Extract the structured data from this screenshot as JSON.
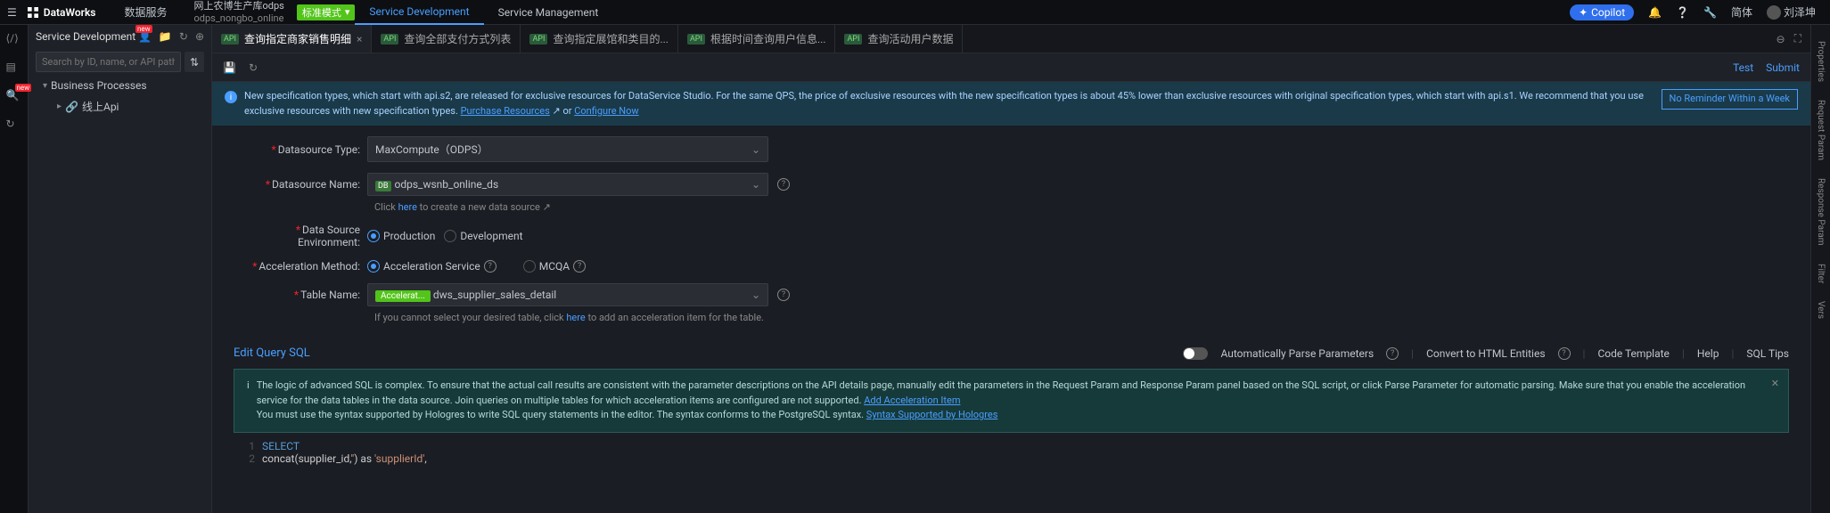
{
  "top": {
    "brand": "DataWorks",
    "nav1": "数据服务",
    "proj1": "网上农博生产库odps",
    "proj2": "odps_nongbo_online",
    "env": "标准模式",
    "nav_active": "Service Development",
    "nav2": "Service Management",
    "copilot": "Copilot",
    "lang": "简体",
    "user": "刘泽坤"
  },
  "side": {
    "title": "Service Development",
    "search_ph": "Search by ID, name, or API path",
    "root": "Business Processes",
    "child": "线上Api"
  },
  "tabs": [
    {
      "label": "查询指定商家销售明细",
      "active": true
    },
    {
      "label": "查询全部支付方式列表"
    },
    {
      "label": "查询指定展馆和类目的..."
    },
    {
      "label": "根据时间查询用户信息..."
    },
    {
      "label": "查询活动用户数据"
    }
  ],
  "toolbar": {
    "test": "Test",
    "submit": "Submit"
  },
  "banner": {
    "msg1": "New specification types, which start with api.s2, are released for exclusive resources for DataService Studio. For the same QPS, the price of exclusive resources with the new specification types is about 45% lower than exclusive resources with original specification types, which start with api.s1. We recommend that you use exclusive resources with new specification types. ",
    "link1": "Purchase Resources",
    "or": " or ",
    "link2": "Configure Now",
    "no_remind": "No Reminder Within a Week"
  },
  "form": {
    "ds_type_l": "Datasource Type:",
    "ds_type_v": "MaxCompute（ODPS）",
    "ds_name_l": "Datasource Name:",
    "ds_name_v": "odps_wsnb_online_ds",
    "ds_hint_a": "Click ",
    "ds_hint_link": "here",
    "ds_hint_b": " to create a new data source",
    "env_l": "Data Source Environment:",
    "env_prod": "Production",
    "env_dev": "Development",
    "acc_l": "Acceleration Method:",
    "acc_svc": "Acceleration Service",
    "acc_mcqa": "MCQA",
    "tbl_l": "Table Name:",
    "tbl_tag": "Accelerat...",
    "tbl_v": "dws_supplier_sales_detail",
    "tbl_hint_a": "If you cannot select your desired table, click ",
    "tbl_hint_link": "here",
    "tbl_hint_b": " to add an acceleration item for the table."
  },
  "sql_section": {
    "title": "Edit Query SQL",
    "auto_parse": "Automatically Parse Parameters",
    "html_ent": "Convert to HTML Entities",
    "code_tpl": "Code Template",
    "help": "Help",
    "tips": "SQL Tips"
  },
  "sql_banner": {
    "msg": "The logic of advanced SQL is complex. To ensure that the actual call results are consistent with the parameter descriptions on the API details page, manually edit the parameters in the Request Param and Response Param panel based on the SQL script, or click Parse Parameter for automatic parsing. Make sure that you enable the acceleration service for the data tables in the data source. Join queries on multiple tables for which acceleration items are configured are not supported. ",
    "link1": "Add Acceleration Item",
    "msg2": " You must use the syntax supported by Hologres to write SQL query statements in the editor. The syntax conforms to the PostgreSQL syntax. ",
    "link2": "Syntax Supported by Hologres"
  },
  "code": {
    "l1": "SELECT",
    "l2a": "    concat(supplier_id,",
    "l2b": "''",
    "l2c": ") as ",
    "l2d": "'supplierId'",
    "l2e": ","
  },
  "rrail": {
    "p": "Properties",
    "rq": "Request Param",
    "rs": "Response Param",
    "f": "Filter",
    "v": "Vers"
  }
}
